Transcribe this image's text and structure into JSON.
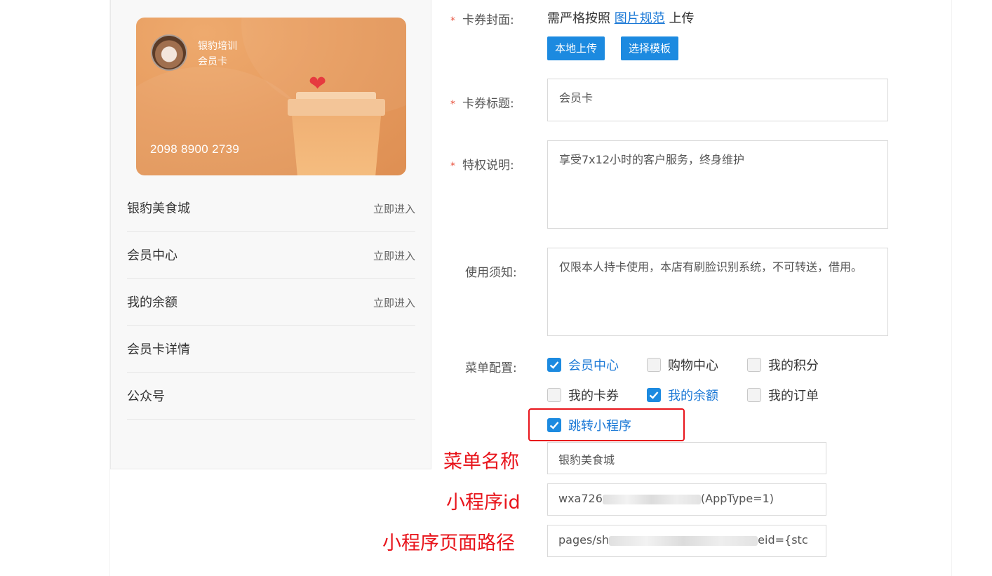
{
  "card": {
    "brand_name": "银豹培训",
    "card_name": "会员卡",
    "card_number": "2098 8900 2739",
    "background_color": "#e79c5f",
    "decoration_icons": [
      "avatar-icon",
      "coffee-cup-icon",
      "heart-icon"
    ]
  },
  "preview_menu": [
    {
      "label": "银豹美食城",
      "action": "立即进入"
    },
    {
      "label": "会员中心",
      "action": "立即进入"
    },
    {
      "label": "我的余额",
      "action": "立即进入"
    },
    {
      "label": "会员卡详情",
      "action": ""
    },
    {
      "label": "公众号",
      "action": ""
    }
  ],
  "form": {
    "required_mark": "*",
    "cover": {
      "label": "卡券封面:",
      "text_before": "需严格按照",
      "link_text": "图片规范",
      "text_after": "上传",
      "upload_button": "本地上传",
      "template_button": "选择模板"
    },
    "title": {
      "label": "卡券标题:",
      "value": "会员卡"
    },
    "privilege": {
      "label": "特权说明:",
      "value": "享受7x12小时的客户服务，终身维护"
    },
    "notice": {
      "label": "使用须知:",
      "value": "仅限本人持卡使用，本店有刷脸识别系统，不可转送，借用。"
    },
    "menu_config": {
      "label": "菜单配置:",
      "options": [
        {
          "label": "会员中心",
          "checked": true
        },
        {
          "label": "购物中心",
          "checked": false
        },
        {
          "label": "我的积分",
          "checked": false
        },
        {
          "label": "我的卡券",
          "checked": false
        },
        {
          "label": "我的余额",
          "checked": true
        },
        {
          "label": "我的订单",
          "checked": false
        },
        {
          "label": "跳转小程序",
          "checked": true
        }
      ]
    },
    "menu_name": {
      "label": "菜单名称",
      "value": "银豹美食城"
    },
    "miniprogram_id": {
      "label": "小程序id",
      "value_prefix": "wxa726",
      "value_suffix": "(AppType=1)"
    },
    "miniprogram_path": {
      "label": "小程序页面路径",
      "value_prefix": "pages/sh",
      "value_suffix": "eid={stc"
    }
  },
  "colors": {
    "accent": "#1c8ae0",
    "highlight": "#e8141b",
    "required": "#e8533f"
  }
}
